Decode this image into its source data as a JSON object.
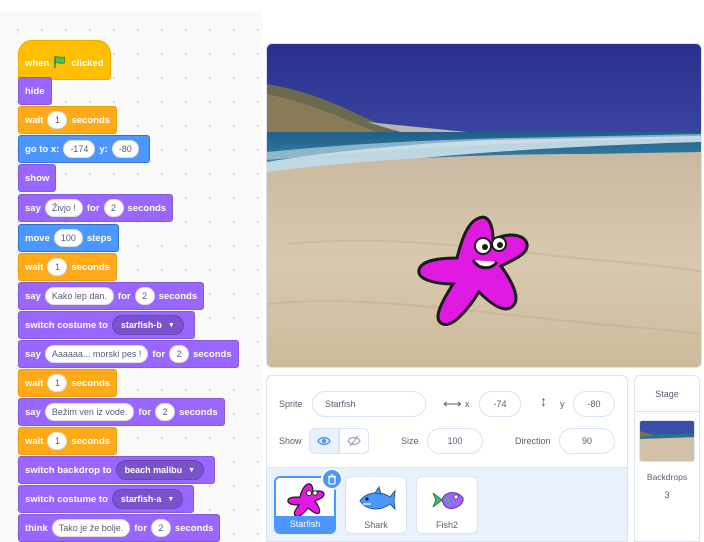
{
  "code_blocks": {
    "when_label": "when",
    "clicked_label": "clicked",
    "hide": "hide",
    "wait1": {
      "label": "wait",
      "value": "1",
      "unit": "seconds"
    },
    "goto": {
      "label": "go to x:",
      "x": "-174",
      "y_label": "y:",
      "y": "-80"
    },
    "show": "show",
    "say1": {
      "label": "say",
      "text": "Živjo !",
      "for": "for",
      "secs": "2",
      "unit": "seconds"
    },
    "move": {
      "label": "move",
      "value": "100",
      "unit": "steps"
    },
    "wait2": {
      "label": "wait",
      "value": "1",
      "unit": "seconds"
    },
    "say2": {
      "label": "say",
      "text": "Kako lep dan.",
      "for": "for",
      "secs": "2",
      "unit": "seconds"
    },
    "costume1": {
      "label": "switch costume to",
      "value": "starfish-b"
    },
    "say3": {
      "label": "say",
      "text": "Aaaaaa... morski pes !",
      "for": "for",
      "secs": "2",
      "unit": "seconds"
    },
    "wait3": {
      "label": "wait",
      "value": "1",
      "unit": "seconds"
    },
    "say4": {
      "label": "say",
      "text": "Bežim ven iz vode.",
      "for": "for",
      "secs": "2",
      "unit": "seconds"
    },
    "wait4": {
      "label": "wait",
      "value": "1",
      "unit": "seconds"
    },
    "backdrop": {
      "label": "switch backdrop to",
      "value": "beach malibu"
    },
    "costume2": {
      "label": "switch costume to",
      "value": "starfish-a"
    },
    "think": {
      "label": "think",
      "text": "Tako je že bolje.",
      "for": "for",
      "secs": "2",
      "unit": "seconds"
    }
  },
  "sprite_info": {
    "sprite_label": "Sprite",
    "sprite_name": "Starfish",
    "x_label": "x",
    "x_value": "-74",
    "y_label": "y",
    "y_value": "-80",
    "show_label": "Show",
    "size_label": "Size",
    "size_value": "100",
    "direction_label": "Direction",
    "direction_value": "90"
  },
  "sprites": [
    {
      "name": "Starfish",
      "selected": true
    },
    {
      "name": "Shark",
      "selected": false
    },
    {
      "name": "Fish2",
      "selected": false
    }
  ],
  "stage_panel": {
    "title": "Stage",
    "backdrops_label": "Backdrops",
    "backdrops_count": "3"
  },
  "colors": {
    "events": "#ffbf00",
    "looks": "#9966ff",
    "control": "#ffab19",
    "motion": "#4c97ff",
    "selected_accent": "#4c97ff"
  }
}
